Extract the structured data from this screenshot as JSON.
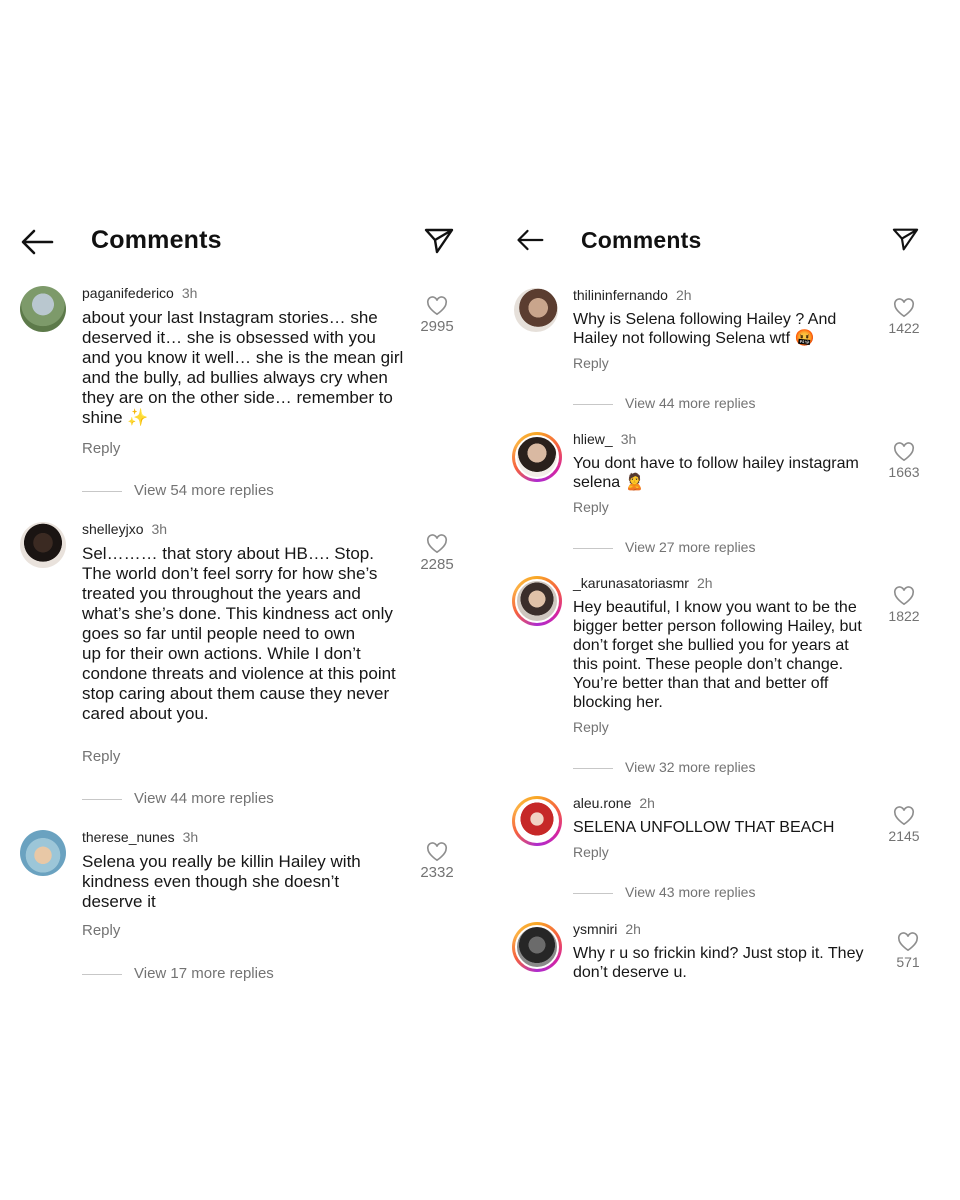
{
  "left": {
    "title": "Comments",
    "comments": [
      {
        "username": "paganifederico",
        "time": "3h",
        "text": "about your last Instagram stories… she\ndeserved it… she is obsessed with you\nand you know it well… she is the mean girl\nand the bully, ad bullies always cry when\nthey are on the other side… remember to\nshine ✨",
        "likes": "2995",
        "reply": "Reply",
        "view_replies": "View 54 more replies"
      },
      {
        "username": "shelleyjxo",
        "time": "3h",
        "text": "Sel……… that story about HB…. Stop.\nThe world don’t feel sorry for how she’s\ntreated you throughout the years and\nwhat’s she’s done. This kindness act only\ngoes so far until people need to own\nup for their own actions. While I don’t\ncondone threats and violence at this point\nstop caring about them cause they never\ncared about you.",
        "likes": "2285",
        "reply": "Reply",
        "view_replies": "View 44 more replies"
      },
      {
        "username": "therese_nunes",
        "time": "3h",
        "text": "Selena you really be killin Hailey with\nkindness even though she doesn’t\ndeserve it",
        "likes": "2332",
        "reply": "Reply",
        "view_replies": "View 17 more replies"
      }
    ]
  },
  "right": {
    "title": "Comments",
    "comments": [
      {
        "username": "thilininfernando",
        "time": "2h",
        "text": "Why is Selena following Hailey ? And\nHailey not following Selena wtf 🤬",
        "likes": "1422",
        "reply": "Reply",
        "view_replies": "View 44 more replies"
      },
      {
        "username": "hliew_",
        "time": "3h",
        "text": "You dont have to follow hailey instagram\nselena 🙎",
        "likes": "1663",
        "reply": "Reply",
        "view_replies": "View 27 more replies"
      },
      {
        "username": "_karunasatoriasmr",
        "time": "2h",
        "text": "Hey beautiful, I know you want to be the\nbigger better person following Hailey, but\ndon’t forget she bullied you for years at\nthis point. These people don’t change.\nYou’re better than that and better off\nblocking her.",
        "likes": "1822",
        "reply": "Reply",
        "view_replies": "View 32 more replies"
      },
      {
        "username": "aleu.rone",
        "time": "2h",
        "text": "SELENA UNFOLLOW THAT BEACH",
        "likes": "2145",
        "reply": "Reply",
        "view_replies": "View 43 more replies"
      },
      {
        "username": "ysmniri",
        "time": "2h",
        "text": "Why r u so frickin kind? Just stop it. They\ndon’t deserve u.",
        "likes": "571"
      }
    ]
  },
  "icons": {
    "back": "arrow-left-icon",
    "send": "paper-plane-icon",
    "like": "heart-outline-icon"
  },
  "colors": {
    "secondary_text": "#737373",
    "story_ring": "#d6249f"
  }
}
